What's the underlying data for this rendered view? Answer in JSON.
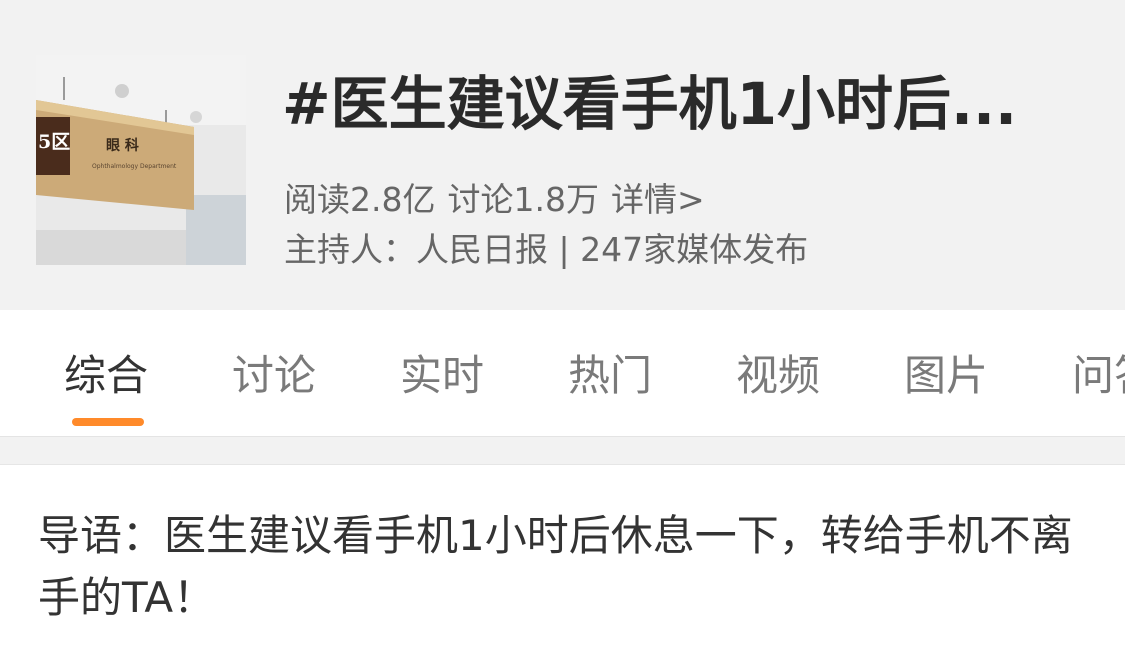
{
  "topic": {
    "title": "#医生建议看手机1小时后...",
    "cover_image": {
      "sign_text": "眼 科",
      "zone_label": "5区",
      "sign_subtitle": "Ophthalmology Department"
    },
    "stats": {
      "reads": "阅读2.8亿",
      "discussions": "讨论1.8万",
      "details_link": "详情>"
    },
    "host_line": "主持人：人民日报 | 247家媒体发布"
  },
  "tabs": [
    {
      "label": "综合",
      "active": true
    },
    {
      "label": "讨论",
      "active": false
    },
    {
      "label": "实时",
      "active": false
    },
    {
      "label": "热门",
      "active": false
    },
    {
      "label": "视频",
      "active": false
    },
    {
      "label": "图片",
      "active": false
    },
    {
      "label": "问答",
      "active": false
    }
  ],
  "intro": {
    "text": "导语：医生建议看手机1小时后休息一下，转给手机不离手的TA！"
  },
  "colors": {
    "header_bg": "#f2f2f2",
    "accent": "#ff8a2a",
    "title_text": "#2a2a2a",
    "meta_text": "#666666"
  }
}
